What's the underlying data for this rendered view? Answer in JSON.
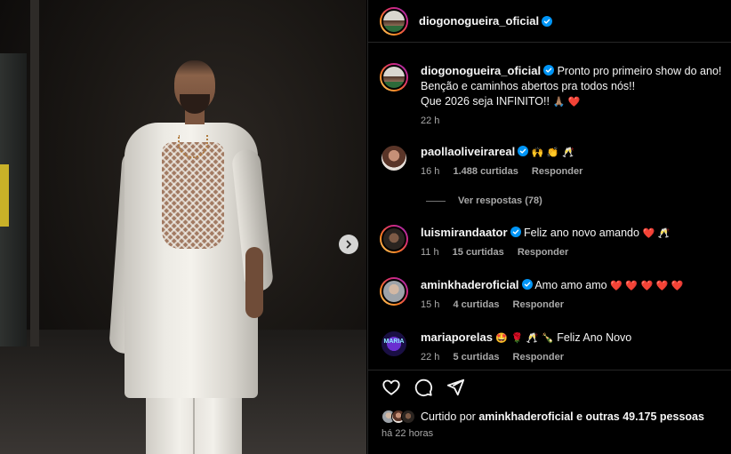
{
  "post": {
    "author": "diogonogueira_oficial",
    "verified": true,
    "caption_lines": [
      "Pronto pro primeiro show do ano!",
      "Benção e caminhos abertos pra todos nós!!",
      "Que 2026 seja INFINITO!!"
    ],
    "caption_emoji": "🙏🏽 ❤️",
    "caption_age": "22 h"
  },
  "comments": [
    {
      "user": "paollaoliveirareal",
      "text": "🙌 👏 🥂",
      "age": "16 h",
      "likes": "1.488 curtidas",
      "reply": "Responder"
    },
    {
      "user": "luismirandaator",
      "text": "Feliz ano novo amando",
      "emoji": "❤️ 🥂",
      "age": "11 h",
      "likes": "15 curtidas",
      "reply": "Responder"
    },
    {
      "user": "aminkhaderoficial",
      "text": "Amo amo amo",
      "emoji": "❤️ ❤️ ❤️ ❤️ ❤️",
      "age": "15 h",
      "likes": "4 curtidas",
      "reply": "Responder"
    },
    {
      "user": "mariaporelas",
      "prefix_emoji": "🤩 🌹 🥂 🍾",
      "text": "Feliz Ano Novo",
      "age": "22 h",
      "likes": "5 curtidas",
      "reply": "Responder"
    }
  ],
  "view_replies": "Ver respostas (78)",
  "maria_avatar_text": "MARIA",
  "liked_by": {
    "prefix": "Curtido por",
    "user": "aminkhaderoficial",
    "suffix": "e outras 49.175 pessoas"
  },
  "timestamp": "há 22 horas",
  "icons": [
    "chevron-right-icon",
    "verified-badge-icon",
    "heart-icon",
    "comment-icon",
    "share-icon"
  ],
  "colors": {
    "verified": "#0095f6",
    "heart": "#ff3040",
    "muted": "#a8a8a8",
    "background": "#000000"
  }
}
